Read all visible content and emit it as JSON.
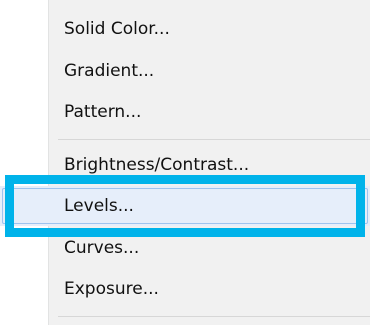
{
  "menu": {
    "items": [
      {
        "label": "Solid Color..."
      },
      {
        "label": "Gradient..."
      },
      {
        "label": "Pattern..."
      },
      {
        "label": "Brightness/Contrast..."
      },
      {
        "label": "Levels..."
      },
      {
        "label": "Curves..."
      },
      {
        "label": "Exposure..."
      }
    ],
    "highlighted_item": "Levels..."
  },
  "colors": {
    "menu_background": "#f1f1f1",
    "highlight_fill": "#e6eefa",
    "highlight_border": "#9fc3ee",
    "focus_ring": "#00b3ea"
  }
}
